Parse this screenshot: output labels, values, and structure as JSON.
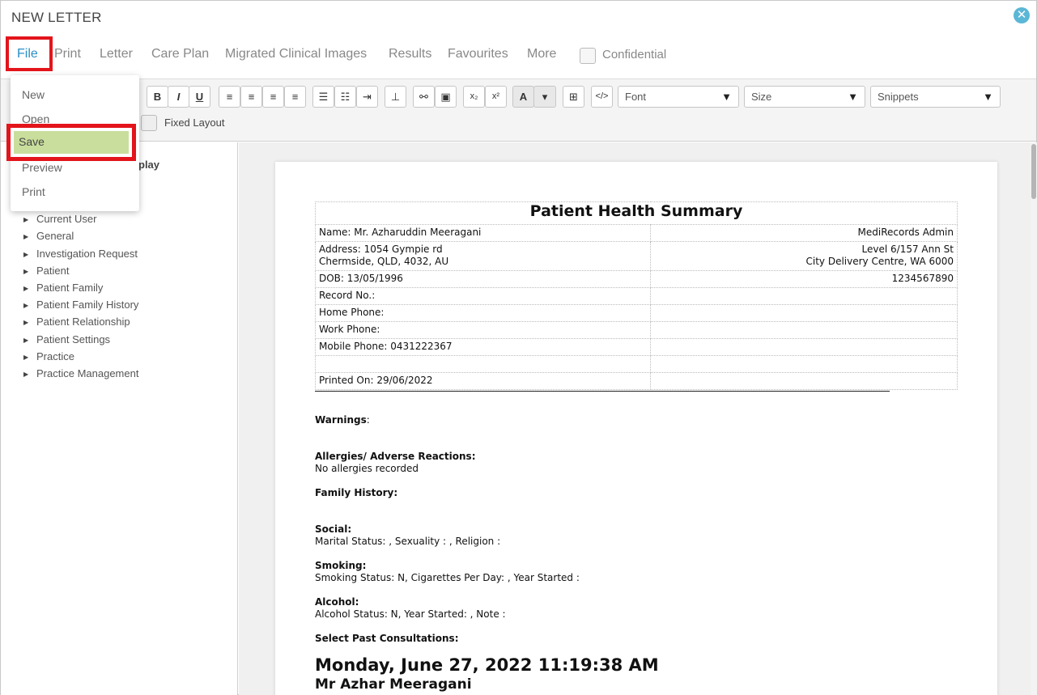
{
  "window": {
    "title": "NEW LETTER",
    "close_icon": "close-icon"
  },
  "menubar": {
    "file": "File",
    "print": "Print",
    "letter": "Letter",
    "care_plan": "Care Plan",
    "migrated_clinical_images": "Migrated Clinical Images",
    "results": "Results",
    "favourites": "Favourites",
    "more": "More",
    "confidential": "Confidential"
  },
  "file_menu": {
    "items": [
      "New",
      "Open",
      "Save",
      "Preview",
      "Print"
    ],
    "highlighted": "Save"
  },
  "toolbar": {
    "bold": "B",
    "italic": "I",
    "underline": "U",
    "subscript": "x₂",
    "superscript": "x²",
    "font_color": "A",
    "font_select": "Font",
    "size_select": "Size",
    "snippets_select": "Snippets",
    "fixed_layout": "Fixed Layout"
  },
  "left_panel": {
    "heading": "play",
    "tree": [
      "Current User",
      "General",
      "Investigation Request",
      "Patient",
      "Patient Family",
      "Patient Family History",
      "Patient Relationship",
      "Patient Settings",
      "Practice",
      "Practice Management"
    ]
  },
  "document": {
    "title": "Patient Health Summary",
    "name": "Name: Mr. Azharuddin Meeragani",
    "practice_admin": "MediRecords Admin",
    "address_line1": "Address: 1054 Gympie rd",
    "address_line2": "Chermside, QLD, 4032, AU",
    "practice_addr1": "Level 6/157 Ann St",
    "practice_addr2": "City Delivery Centre, WA 6000",
    "dob": "DOB: 13/05/1996",
    "practice_phone": "1234567890",
    "record_no": "Record No.:",
    "home_phone": "Home Phone:",
    "work_phone": "Work Phone:",
    "mobile_phone": "Mobile Phone: 0431222367",
    "printed_on": "Printed On: 29/06/2022",
    "warnings_label": "Warnings",
    "warnings_colon": ":",
    "allergies_label": "Allergies/ Adverse Reactions:",
    "allergies_value": "No allergies recorded",
    "family_history_label": "Family History:",
    "social_label": "Social:",
    "social_value": "Marital Status: , Sexuality : , Religion :",
    "smoking_label": "Smoking:",
    "smoking_value": "Smoking Status: N, Cigarettes Per Day: , Year Started :",
    "alcohol_label": "Alcohol:",
    "alcohol_value": "Alcohol Status: N, Year Started: , Note :",
    "past_consultations_label": "Select Past Consultations:",
    "consult_date": "Monday, June 27, 2022 11:19:38 AM",
    "consult_doctor": "Mr Azhar Meeragani"
  },
  "colors": {
    "accent": "#2a8fc4",
    "highlight_box": "#e3141b",
    "save_highlight": "#c9de9c"
  }
}
